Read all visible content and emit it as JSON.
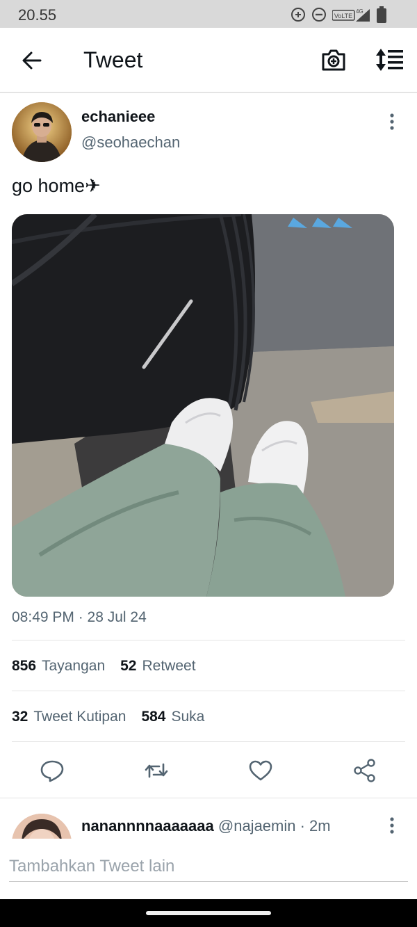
{
  "status_bar": {
    "time": "20.55",
    "network_label": "VoLTE",
    "network_gen": "4G"
  },
  "app_bar": {
    "title": "Tweet"
  },
  "tweet": {
    "author_name": "echanieee",
    "author_handle": "@seohaechan",
    "text": "go home✈",
    "timestamp": "08:49 PM · 28 Jul 24",
    "stats": [
      {
        "count": "856",
        "label": "Tayangan"
      },
      {
        "count": "52",
        "label": "Retweet"
      },
      {
        "count": "32",
        "label": "Tweet Kutipan"
      },
      {
        "count": "584",
        "label": "Suka"
      }
    ]
  },
  "reply": {
    "author_name": "nanannnnaaaaaaa",
    "meta": "@najaemin · 2m"
  },
  "compose": {
    "placeholder": "Tambahkan Tweet lain"
  },
  "icons": {
    "back": "arrow-left-icon",
    "camera": "camera-plus-icon",
    "sort": "sort-icon",
    "more": "more-vertical-icon",
    "reply": "reply-icon",
    "retweet": "retweet-icon",
    "like": "heart-icon",
    "share": "share-icon"
  },
  "colors": {
    "text_primary": "#0f1419",
    "text_secondary": "#536471",
    "divider": "#e4e4e4",
    "status_bar_bg": "#d9d9d9"
  }
}
